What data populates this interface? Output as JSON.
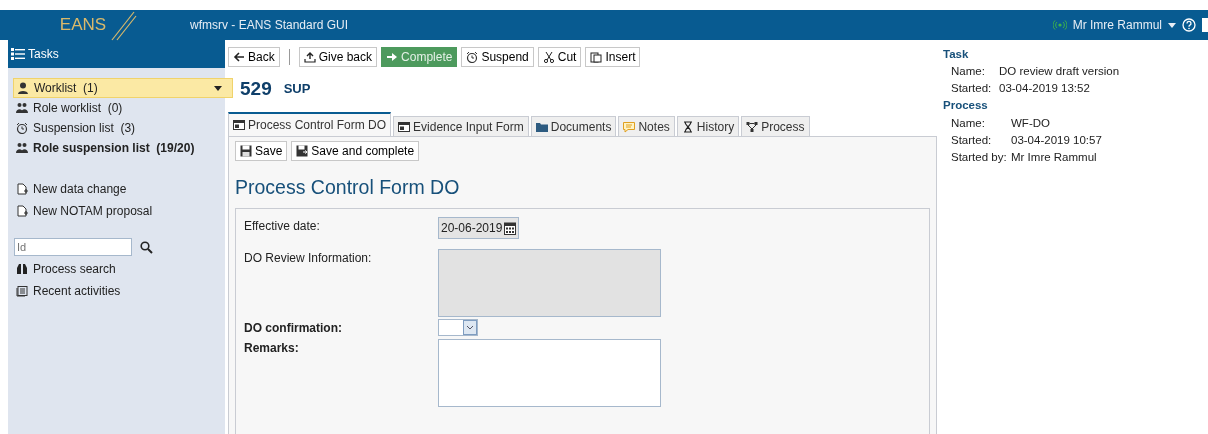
{
  "header": {
    "logo": "EANS",
    "title": "wfmsrv - EANS Standard GUI",
    "user": "Mr Imre Rammul",
    "connected": true
  },
  "sidebar": {
    "title": "Tasks",
    "lists": [
      {
        "label": "Worklist  (1)",
        "selected": true,
        "bold": false
      },
      {
        "label": "Role worklist  (0)",
        "selected": false,
        "bold": false
      },
      {
        "label": "Suspension list  (3)",
        "selected": false,
        "bold": false
      },
      {
        "label": "Role suspension list  (19/20)",
        "selected": false,
        "bold": true
      }
    ],
    "actions": [
      "New data change",
      "New NOTAM proposal"
    ],
    "search": {
      "placeholder": "Id"
    },
    "links": [
      "Process search",
      "Recent activities"
    ]
  },
  "toolbar": [
    {
      "kind": "button",
      "label": "Back",
      "primary": false
    },
    {
      "kind": "separator"
    },
    {
      "kind": "button",
      "label": "Give back",
      "primary": false
    },
    {
      "kind": "button",
      "label": "Complete",
      "primary": true
    },
    {
      "kind": "button",
      "label": "Suspend",
      "primary": false
    },
    {
      "kind": "button",
      "label": "Cut",
      "primary": false
    },
    {
      "kind": "button",
      "label": "Insert",
      "primary": false
    }
  ],
  "task": {
    "number": "529",
    "code": "SUP"
  },
  "tabs": [
    {
      "label": "Process Control Form DO",
      "selected": true
    },
    {
      "label": "Evidence Input Form",
      "selected": false
    },
    {
      "label": "Documents",
      "selected": false
    },
    {
      "label": "Notes",
      "selected": false
    },
    {
      "label": "History",
      "selected": false
    },
    {
      "label": "Process",
      "selected": false
    }
  ],
  "form_buttons": [
    "Save",
    "Save and complete"
  ],
  "form": {
    "title": "Process Control Form DO",
    "fields": [
      {
        "kind": "date",
        "label": "Effective date:",
        "value": "20-06-2019",
        "required": false
      },
      {
        "kind": "readonly",
        "label": "DO Review Information:",
        "required": false
      },
      {
        "kind": "select",
        "label": "DO confirmation:",
        "required": true
      },
      {
        "kind": "textarea",
        "label": "Remarks:",
        "required": true
      }
    ]
  },
  "info": [
    {
      "title": "Task",
      "rows": [
        {
          "label": "Name:",
          "value": "DO review draft version"
        },
        {
          "label": "Started:",
          "value": "03-04-2019 13:52"
        }
      ]
    },
    {
      "title": "Process",
      "rows": [
        {
          "label": "Name:",
          "value": "WF-DO"
        },
        {
          "label": "Started:",
          "value": "03-04-2019 10:57"
        },
        {
          "label": "Started by:",
          "value": "Mr Imre Rammul"
        }
      ]
    }
  ]
}
